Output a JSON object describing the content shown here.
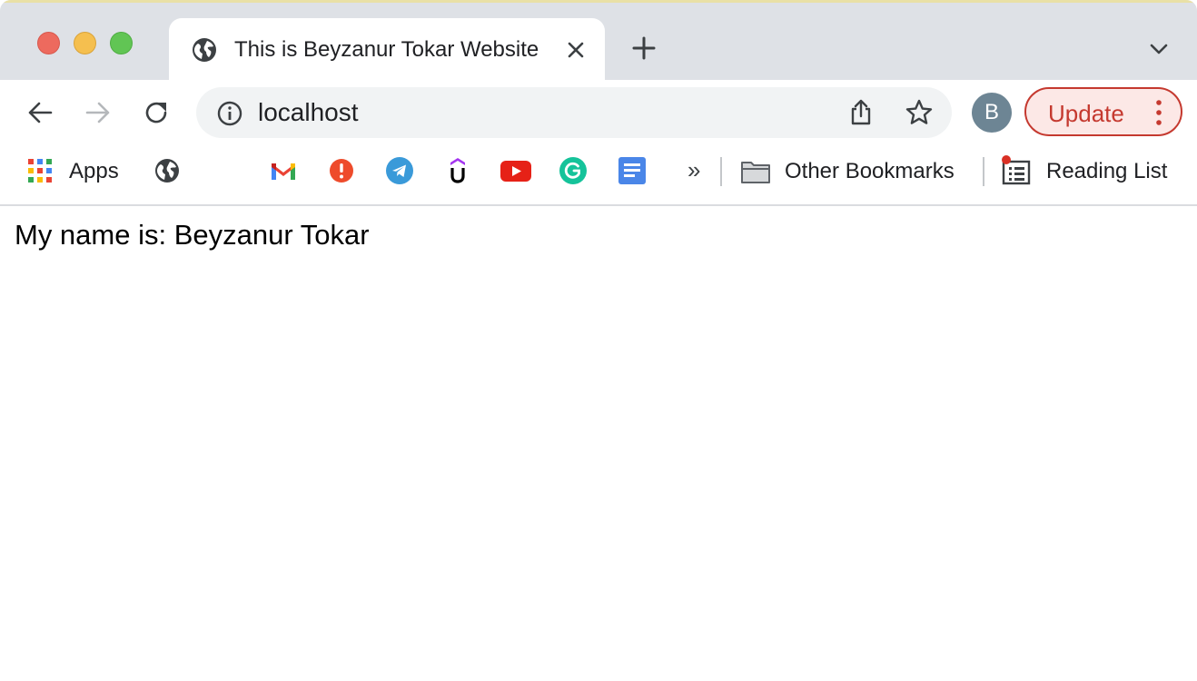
{
  "browser": {
    "tab": {
      "title": "This is Beyzanur Tokar Website"
    },
    "address_bar": {
      "url": "localhost"
    },
    "profile_initial": "B",
    "update_label": "Update"
  },
  "bookmarks": {
    "apps_label": "Apps",
    "overflow_glyph": "»",
    "other_bookmarks_label": "Other Bookmarks",
    "reading_list_label": "Reading List",
    "items": [
      {
        "icon": "globe-icon"
      },
      {
        "icon": "gmail-icon"
      },
      {
        "icon": "alert-icon"
      },
      {
        "icon": "telegram-icon"
      },
      {
        "icon": "udemy-icon"
      },
      {
        "icon": "youtube-icon"
      },
      {
        "icon": "grammarly-icon"
      },
      {
        "icon": "google-docs-icon"
      }
    ]
  },
  "page": {
    "text": "My name is: Beyzanur Tokar"
  },
  "colors": {
    "tabstrip_bg": "#dee1e6",
    "update_accent": "#c5392f",
    "avatar_bg": "#6d8594"
  }
}
